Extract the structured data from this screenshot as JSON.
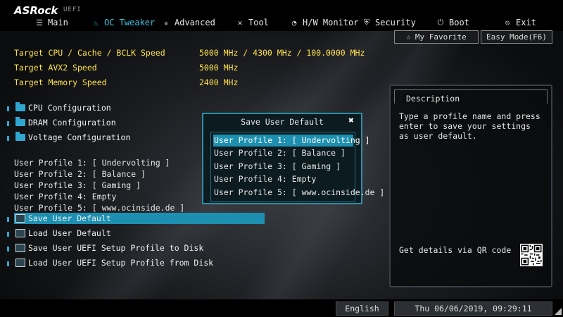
{
  "brand": {
    "name": "ASRock",
    "sub": "UEFI"
  },
  "tabs": [
    {
      "label": "Main",
      "icon": "list-icon"
    },
    {
      "label": "OC Tweaker",
      "icon": "flame-icon",
      "active": true
    },
    {
      "label": "Advanced",
      "icon": "star-icon"
    },
    {
      "label": "Tool",
      "icon": "tools-icon"
    },
    {
      "label": "H/W Monitor",
      "icon": "monitor-icon"
    },
    {
      "label": "Security",
      "icon": "shield-icon"
    },
    {
      "label": "Boot",
      "icon": "power-icon"
    },
    {
      "label": "Exit",
      "icon": "exit-icon"
    }
  ],
  "toolbar": {
    "favorite": "My Favorite",
    "easy_mode": "Easy Mode(F6)"
  },
  "info": [
    {
      "label": "Target CPU / Cache / BCLK Speed",
      "value": "5000 MHz / 4300 MHz / 100.0000 MHz"
    },
    {
      "label": "Target AVX2 Speed",
      "value": "5000 MHz"
    },
    {
      "label": "Target Memory Speed",
      "value": "2400 MHz"
    }
  ],
  "menu": [
    {
      "label": "CPU Configuration"
    },
    {
      "label": "DRAM Configuration"
    },
    {
      "label": "Voltage Configuration"
    }
  ],
  "profiles": [
    "User Profile 1: [ Undervolting ]",
    "User Profile 2: [ Balance ]",
    "User Profile 3: [ Gaming ]",
    "User Profile 4: Empty",
    "User Profile 5: [ www.ocinside.de ]"
  ],
  "actions": [
    {
      "label": "Save User Default",
      "selected": true
    },
    {
      "label": "Load User Default"
    },
    {
      "label": "Save User UEFI Setup Profile to Disk"
    },
    {
      "label": "Load User UEFI Setup Profile from Disk"
    }
  ],
  "dialog": {
    "title": "Save User Default",
    "options": [
      "User Profile 1: [ Undervolting ]",
      "User Profile 2: [ Balance ]",
      "User Profile 3: [ Gaming ]",
      "User Profile 4: Empty",
      "User Profile 5: [ www.ocinside.de ]"
    ]
  },
  "description": {
    "title": "Description",
    "text": "Type a profile name and press enter to save your settings as user default.",
    "qr_label": "Get details via QR code"
  },
  "footer": {
    "language": "English",
    "datetime": "Thu 06/06/2019, 09:29:11"
  },
  "colors": {
    "accent": "#1d8fb0",
    "info_text": "#ffe24a",
    "active_tab": "#3ac2e0"
  }
}
